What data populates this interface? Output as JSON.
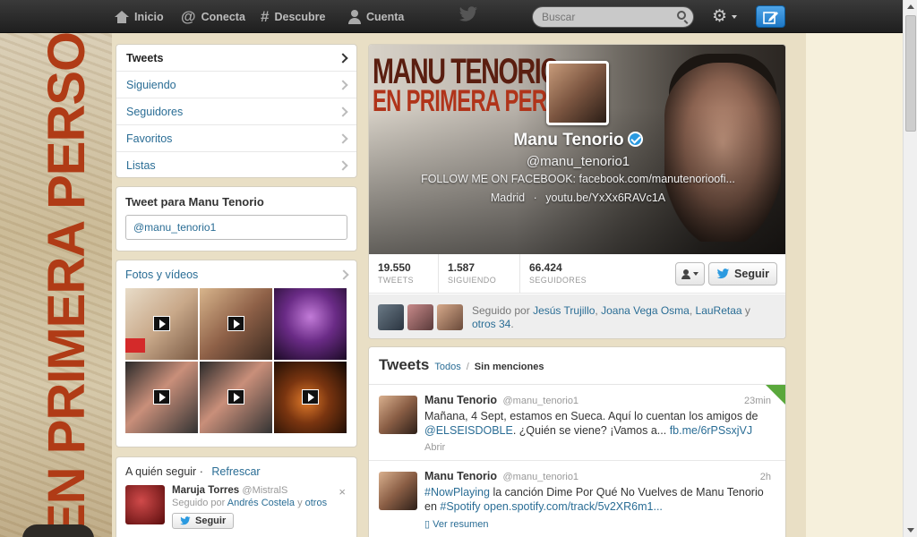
{
  "topbar": {
    "nav": [
      {
        "label": "Inicio",
        "icon": "home-icon"
      },
      {
        "label": "Conecta",
        "icon": "at-icon"
      },
      {
        "label": "Descubre",
        "icon": "hash-icon"
      },
      {
        "label": "Cuenta",
        "icon": "user-icon"
      }
    ],
    "search_placeholder": "Buscar",
    "gear": "⚙"
  },
  "sidebar": {
    "nav": [
      {
        "label": "Tweets",
        "active": true
      },
      {
        "label": "Siguiendo"
      },
      {
        "label": "Seguidores"
      },
      {
        "label": "Favoritos"
      },
      {
        "label": "Listas"
      }
    ],
    "tweet_to_title": "Tweet para Manu Tenorio",
    "tweet_to_value": "@manu_tenorio1",
    "media_title": "Fotos y vídeos",
    "who": {
      "title": "A quién seguir",
      "sep": "·",
      "refresh": "Refrescar",
      "name": "Maruja Torres",
      "handle": "@MistralS",
      "followed_prefix": "Seguido por",
      "followed_by": "Andrés Costela",
      "conj": "y",
      "others": "otros",
      "follow": "Seguir",
      "close": "×"
    }
  },
  "background": {
    "vertical_text": "EN PRIMERA PERSONA"
  },
  "profile": {
    "hero_title_1": "MANU TENORIO",
    "hero_title_2": "EN PRIMERA PERSONA",
    "name": "Manu Tenorio",
    "handle": "@manu_tenorio1",
    "bio": "FOLLOW ME ON FACEBOOK: facebook.com/manutenorioofi...",
    "location": "Madrid",
    "dot": "·",
    "url": "youtu.be/YxXx6RAVc1A",
    "stats": [
      {
        "num": "19.550",
        "label": "TWEETS"
      },
      {
        "num": "1.587",
        "label": "SIGUIENDO"
      },
      {
        "num": "66.424",
        "label": "SEGUIDORES"
      }
    ],
    "follow": "Seguir",
    "followed_prefix": "Seguido por",
    "followed_1": "Jesús Trujillo",
    "comma": ",",
    "followed_2": "Joana Vega Osma",
    "followed_3": "LauRetaa",
    "conj": "y",
    "followed_others": "otros 34",
    "period": "."
  },
  "stream": {
    "title": "Tweets",
    "filter_all": "Todos",
    "sep": "/",
    "filter_none": "Sin menciones",
    "tweets": [
      {
        "name": "Manu Tenorio",
        "handle": "@manu_tenorio1",
        "time": "23min",
        "text_1": "Mañana, 4 Sept, estamos en Sueca. Aquí lo cuentan los amigos de ",
        "mention": "@ELSEISDOBLE",
        "text_2": ". ¿Quién se viene? ¡Vamos a... ",
        "link": "fb.me/6rPSsxjVJ",
        "meta": "Abrir"
      },
      {
        "name": "Manu Tenorio",
        "handle": "@manu_tenorio1",
        "time": "2h",
        "hashtag1": "#NowPlaying",
        "text_1": " la canción Dime Por Qué No Vuelves de Manu Tenorio en ",
        "hashtag2": "#Spotify",
        "link": "open.spotify.com/track/5v2XR6m1...",
        "meta": "Ver resumen"
      }
    ]
  },
  "colors": {
    "link": "#2a6d95",
    "topbar": "#2b2b2b",
    "accent_red": "#b03b16",
    "compose": "#1e78c6",
    "verified": "#2b9ae0"
  }
}
